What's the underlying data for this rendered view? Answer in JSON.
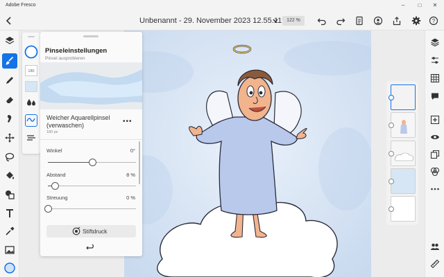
{
  "app": {
    "title": "Adobe Fresco"
  },
  "window_controls": {
    "minimize": "–",
    "maximize": "□",
    "close": "✕"
  },
  "toolbar": {
    "back_icon": "chevron-left-icon",
    "document_title": "Unbenannt - 29. November 2023 12.55.11*",
    "zoom": "122 %"
  },
  "brush_panel": {
    "title": "Pinseleinstellungen",
    "subtitle": "Pinsel ausprobieren",
    "brush_name": "Weicher Aquarellpinsel (verwaschen)",
    "brush_size": "180 px",
    "more": "•••",
    "sliders": [
      {
        "label": "Winkel",
        "value_text": "0°",
        "level": 0.5
      },
      {
        "label": "Abstand",
        "value_text": "8 %",
        "level": 0.08
      },
      {
        "label": "Streuung",
        "value_text": "0 %",
        "level": 0.0
      }
    ],
    "pressure_button": "Stiftdruck"
  },
  "sub_palette": {
    "size_label": "180"
  },
  "colors": {
    "accent": "#1473e6",
    "canvas_bg": "#dfe9f4",
    "robe": "#b8c9ec",
    "skin": "#f2b48d"
  }
}
